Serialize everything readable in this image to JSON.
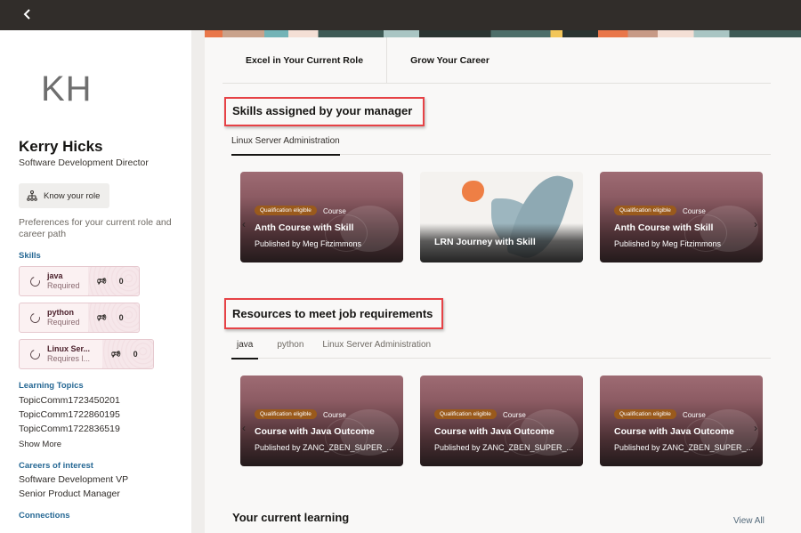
{
  "topbar": {
    "back_icon": "chevron-left-icon"
  },
  "profile": {
    "initials": "KH",
    "name": "Kerry Hicks",
    "job_title": "Software Development Director",
    "know_role_button": "Know your role",
    "preferences_text": "Preferences for your current role and career path"
  },
  "skills": {
    "heading": "Skills",
    "items": [
      {
        "name": "java",
        "status": "Required",
        "count": "0"
      },
      {
        "name": "python",
        "status": "Required",
        "count": "0"
      },
      {
        "name": "Linux Ser...",
        "status": "Requires l...",
        "count": "0"
      }
    ]
  },
  "learning_topics": {
    "heading": "Learning Topics",
    "items": [
      "TopicComm1723450201",
      "TopicComm1722860195",
      "TopicComm1722836519"
    ],
    "show_more": "Show More"
  },
  "careers": {
    "heading": "Careers of interest",
    "items": [
      "Software Development VP",
      "Senior Product Manager"
    ]
  },
  "connections": {
    "heading": "Connections"
  },
  "page_tabs": [
    {
      "label": "Excel in Your Current Role",
      "active": true
    },
    {
      "label": "Grow Your Career",
      "active": false
    }
  ],
  "manager_skills": {
    "heading": "Skills assigned by your manager",
    "tabs": [
      {
        "label": "Linux Server Administration",
        "active": true
      }
    ],
    "cards": [
      {
        "kind": "course",
        "badge": "Qualification eligible",
        "type": "Course",
        "title": "Anth Course with Skill",
        "publisher": "Published by Meg Fitzimmons"
      },
      {
        "kind": "journey",
        "title": "LRN Journey with Skill"
      },
      {
        "kind": "course",
        "badge": "Qualification eligible",
        "type": "Course",
        "title": "Anth Course with Skill",
        "publisher": "Published by Meg Fitzimmons"
      }
    ]
  },
  "resources": {
    "heading": "Resources to meet job requirements",
    "tabs": [
      {
        "label": "java",
        "active": true
      },
      {
        "label": "python",
        "active": false
      },
      {
        "label": "Linux Server Administration",
        "active": false
      }
    ],
    "cards": [
      {
        "badge": "Qualification eligible",
        "type": "Course",
        "title": "Course with Java Outcome",
        "publisher": "Published by ZANC_ZBEN_SUPER_..."
      },
      {
        "badge": "Qualification eligible",
        "type": "Course",
        "title": "Course with Java Outcome",
        "publisher": "Published by ZANC_ZBEN_SUPER_..."
      },
      {
        "badge": "Qualification eligible",
        "type": "Course",
        "title": "Course with Java Outcome",
        "publisher": "Published by ZANC_ZBEN_SUPER_..."
      }
    ]
  },
  "current_learning": {
    "heading": "Your current learning",
    "view_all": "View All"
  },
  "colors": {
    "accent_link": "#266894",
    "highlight_box": "#e64246",
    "badge": "#9a5a1c",
    "topbar": "#312d2a"
  }
}
